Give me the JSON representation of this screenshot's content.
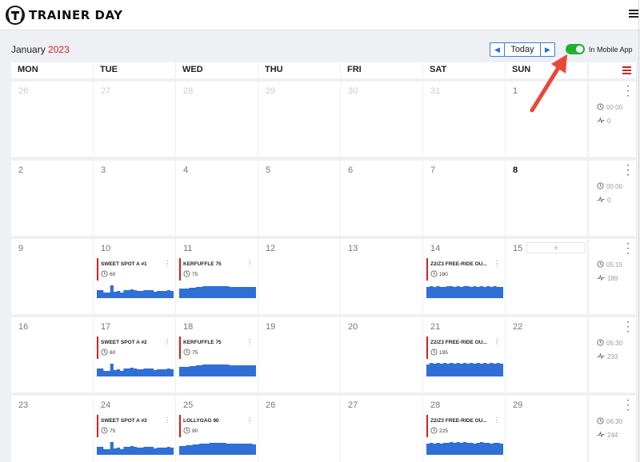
{
  "app": {
    "title": "TRAINER DAY"
  },
  "calendar": {
    "month": "January",
    "year": "2023",
    "nav": {
      "prev_icon": "chevron-left-icon",
      "today_label": "Today",
      "next_icon": "chevron-right-icon"
    },
    "mobile_toggle": {
      "label": "In Mobile App",
      "on": true,
      "color": "#20b12f"
    },
    "weekdays": [
      "MON",
      "TUE",
      "WED",
      "THU",
      "FRI",
      "SAT",
      "SUN"
    ],
    "weeks": [
      {
        "days": [
          "26",
          "27",
          "28",
          "29",
          "30",
          "31",
          "1"
        ],
        "summary_time": "00:00",
        "summary_load": "0"
      },
      {
        "days": [
          "2",
          "3",
          "4",
          "5",
          "6",
          "7",
          "8"
        ],
        "summary_time": "00:00",
        "summary_load": "0"
      },
      {
        "days": [
          "9",
          "10",
          "11",
          "12",
          "13",
          "14",
          "15"
        ],
        "summary_time": "05:15",
        "summary_load": "189"
      },
      {
        "days": [
          "16",
          "17",
          "18",
          "19",
          "20",
          "21",
          "22"
        ],
        "summary_time": "05:30",
        "summary_load": "233"
      },
      {
        "days": [
          "23",
          "24",
          "25",
          "26",
          "27",
          "28",
          "29"
        ],
        "summary_time": "06:30",
        "summary_load": "244"
      }
    ],
    "workouts": [
      {
        "name": "SWEET SPOT A #1",
        "value": "60"
      },
      {
        "name": "KERFUFFLE 75",
        "value": "75"
      },
      {
        "name": "Z2/Z3 FREE-RIDE OU...",
        "value": "180"
      },
      {
        "name": "SWEET SPOT A #2",
        "value": "60"
      },
      {
        "name": "KERFUFFLE 75",
        "value": "75"
      },
      {
        "name": "Z2/Z3 FREE-RIDE OU...",
        "value": "195"
      },
      {
        "name": "SWEET SPOT A #3",
        "value": "75"
      },
      {
        "name": "LOLLYGAG 90",
        "value": "90"
      },
      {
        "name": "Z2/Z3 FREE-RIDE OU...",
        "value": "225"
      }
    ],
    "add_icon": "+",
    "colors": {
      "accent": "#2a6ed8",
      "year": "#d32020",
      "workout_bar": "#d32020",
      "profile": "#2f6fd6",
      "annotation": "#e8473a"
    }
  }
}
